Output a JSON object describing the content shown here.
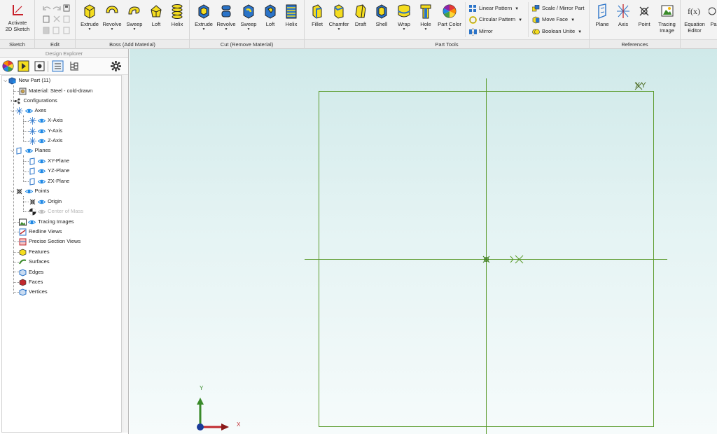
{
  "ribbon": {
    "sketch": {
      "activate_label_1": "Activate",
      "activate_label_2": "2D Sketch",
      "group": "Sketch"
    },
    "edit": {
      "group": "Edit"
    },
    "boss": {
      "group": "Boss (Add Material)",
      "tools": [
        "Extrude",
        "Revolve",
        "Sweep",
        "Loft",
        "Helix"
      ]
    },
    "cut": {
      "group": "Cut (Remove Material)",
      "tools": [
        "Extrude",
        "Revolve",
        "Sweep",
        "Loft",
        "Helix"
      ]
    },
    "part_tools": {
      "group": "Part Tools",
      "tools": [
        "Fillet",
        "Chamfer",
        "Draft",
        "Shell",
        "Wrap",
        "Hole",
        "Part Color"
      ],
      "list1": [
        "Linear Pattern",
        "Circular Pattern",
        "Mirror"
      ],
      "list2": [
        "Scale / Mirror Part",
        "Move Face",
        "Boolean Unite"
      ]
    },
    "references": {
      "group": "References",
      "tools": [
        "Plane",
        "Axis",
        "Point"
      ],
      "tracing_1": "Tracing",
      "tracing_2": "Image"
    },
    "equation": {
      "label_1": "Equation",
      "label_2": "Editor",
      "partial": "Pa"
    }
  },
  "explorer": {
    "title": "Design Explorer",
    "tree": {
      "root": "New Part (11)",
      "material": "Material: Steel - cold-drawn",
      "configurations": "Configurations",
      "axes": "Axes",
      "x_axis": "X-Axis",
      "y_axis": "Y-Axis",
      "z_axis": "Z-Axis",
      "planes": "Planes",
      "xy_plane": "XY-Plane",
      "yz_plane": "YZ-Plane",
      "zx_plane": "ZX-Plane",
      "points": "Points",
      "origin": "Origin",
      "center_of_mass": "Center of Mass",
      "tracing_images": "Tracing Images",
      "redline_views": "Redline Views",
      "precise_section_views": "Precise Section Views",
      "features": "Features",
      "surfaces": "Surfaces",
      "edges": "Edges",
      "faces": "Faces",
      "vertices": "Vertices"
    }
  },
  "canvas": {
    "plane_label": "XY",
    "axis_x": "X",
    "axis_y": "Y"
  },
  "colors": {
    "plane_line": "#5a9a2a",
    "boss_yellow": "#f5dd1f",
    "cut_blue": "#2a73c8",
    "axis_red": "#c0282d",
    "axis_green": "#3a8a2a",
    "axis_blue": "#1a3c9a"
  }
}
